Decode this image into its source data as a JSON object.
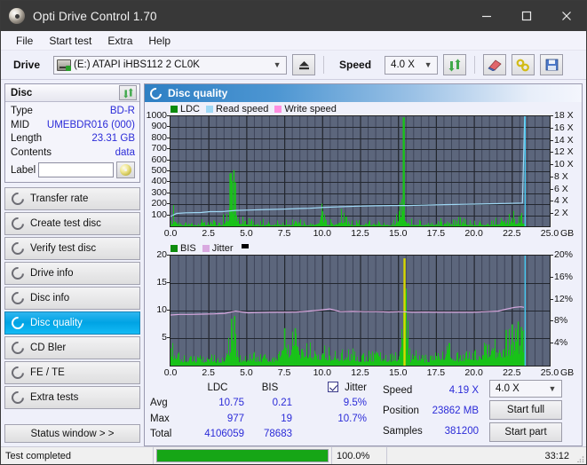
{
  "window": {
    "title": "Opti Drive Control 1.70",
    "app_icon": "disc-icon",
    "minimize": "–",
    "maximize": "□",
    "close": "✕"
  },
  "menu": {
    "items": [
      "File",
      "Start test",
      "Extra",
      "Help"
    ]
  },
  "toolbar": {
    "drive_label": "Drive",
    "drive_value": "(E:)  ATAPI iHBS112  2 CL0K",
    "eject_icon": "eject-icon",
    "speed_label": "Speed",
    "speed_value": "4.0 X",
    "refresh_icon": "refresh-icon",
    "erase_icon": "eraser-icon",
    "tools_icon": "tools-icon",
    "save_icon": "save-icon"
  },
  "disc_panel": {
    "title": "Disc",
    "refresh_icon": "refresh-icon",
    "rows": [
      {
        "key": "Type",
        "value": "BD-R"
      },
      {
        "key": "MID",
        "value": "UMEBDR016 (000)"
      },
      {
        "key": "Length",
        "value": "23.31 GB"
      },
      {
        "key": "Contents",
        "value": "data"
      }
    ],
    "label_key": "Label",
    "label_value": "",
    "label_icon": "cd-icon"
  },
  "sidebar": {
    "items": [
      {
        "label": "Transfer rate",
        "icon": "disc-icon",
        "selected": false
      },
      {
        "label": "Create test disc",
        "icon": "disc-icon",
        "selected": false
      },
      {
        "label": "Verify test disc",
        "icon": "disc-icon",
        "selected": false
      },
      {
        "label": "Drive info",
        "icon": "disc-icon",
        "selected": false
      },
      {
        "label": "Disc info",
        "icon": "disc-icon",
        "selected": false
      },
      {
        "label": "Disc quality",
        "icon": "disc-icon",
        "selected": true
      },
      {
        "label": "CD Bler",
        "icon": "disc-icon",
        "selected": false
      },
      {
        "label": "FE / TE",
        "icon": "disc-icon",
        "selected": false
      },
      {
        "label": "Extra tests",
        "icon": "disc-icon",
        "selected": false
      }
    ],
    "status_window": "Status window > >"
  },
  "content": {
    "header_title": "Disc quality",
    "header_icon": "disc-icon"
  },
  "chart_data": [
    {
      "type": "line",
      "name": "ldc-chart",
      "title": "",
      "xlabel": "GB",
      "ylabel": "",
      "x_unit_label": "GB",
      "xlim": [
        0,
        25
      ],
      "xticks": [
        0.0,
        2.5,
        5.0,
        7.5,
        10.0,
        12.5,
        15.0,
        17.5,
        20.0,
        22.5,
        25.0
      ],
      "xticklabels": [
        "0.0",
        "2.5",
        "5.0",
        "7.5",
        "10.0",
        "12.5",
        "15.0",
        "17.5",
        "20.0",
        "22.5",
        "25.0"
      ],
      "ylim": [
        0,
        1000
      ],
      "yticks": [
        100,
        200,
        300,
        400,
        500,
        600,
        700,
        800,
        900,
        1000
      ],
      "yticklabels": [
        "100",
        "200",
        "300",
        "400",
        "500",
        "600",
        "700",
        "800",
        "900",
        "1000"
      ],
      "y2lim": [
        0,
        18
      ],
      "y2ticks": [
        2,
        4,
        6,
        8,
        10,
        12,
        14,
        16,
        18
      ],
      "y2ticklabels": [
        "2 X",
        "4 X",
        "6 X",
        "8 X",
        "10 X",
        "12 X",
        "14 X",
        "16 X",
        "18 X"
      ],
      "grid": true,
      "legend_position": "top-left",
      "legend": [
        {
          "label": "LDC",
          "color": "#0d8b0d"
        },
        {
          "label": "Read speed",
          "color": "#9fd8f5"
        },
        {
          "label": "Write speed",
          "color": "#ff8fe0"
        }
      ],
      "series": [
        {
          "name": "LDC",
          "type": "bar",
          "color": "#19c219",
          "axis": "left",
          "note": "dense green error bars, baseline ~40-90, spikes at 0.4 (300), 4.2 (510), 9.9 (240), 11.3 (260), 15.4 (990)",
          "x": [
            0.0,
            0.3,
            0.45,
            0.8,
            1.3,
            1.8,
            2.3,
            2.7,
            2.9,
            3.4,
            3.9,
            4.15,
            4.25,
            4.45,
            5.0,
            5.4,
            5.9,
            6.4,
            6.9,
            7.4,
            7.9,
            8.4,
            8.9,
            9.4,
            9.9,
            10.4,
            10.9,
            11.3,
            11.8,
            12.3,
            12.8,
            13.3,
            13.8,
            14.3,
            14.8,
            15.35,
            15.5,
            16.0,
            16.5,
            17.0,
            17.5,
            18.0,
            18.5,
            19.0,
            19.5,
            20.0,
            20.5,
            21.0,
            21.5,
            22.0,
            22.4,
            22.8,
            23.1,
            23.4
          ],
          "y": [
            70,
            300,
            120,
            60,
            55,
            60,
            70,
            140,
            60,
            70,
            480,
            510,
            400,
            110,
            130,
            60,
            70,
            65,
            70,
            60,
            65,
            70,
            60,
            70,
            240,
            60,
            80,
            260,
            70,
            60,
            65,
            60,
            70,
            60,
            65,
            990,
            80,
            70,
            65,
            70,
            80,
            70,
            65,
            100,
            70,
            65,
            60,
            70,
            120,
            150,
            130,
            170,
            200,
            185
          ]
        },
        {
          "name": "Read speed",
          "type": "line",
          "color": "#9fd8f5",
          "axis": "right",
          "x": [
            0.0,
            0.4,
            1.0,
            2.0,
            2.6,
            3.4,
            4.3,
            5.2,
            6.3,
            7.4,
            8.5,
            9.2,
            10.2,
            11.2,
            12.4,
            13.5,
            14.6,
            15.6,
            16.6,
            17.4,
            18.4,
            19.4,
            20.4,
            21.4,
            22.3,
            23.2,
            23.35
          ],
          "y": [
            1.6,
            2.1,
            2.2,
            2.25,
            2.4,
            2.4,
            2.6,
            2.65,
            2.75,
            2.8,
            2.9,
            2.95,
            3.1,
            3.2,
            3.3,
            3.35,
            3.4,
            3.4,
            3.45,
            3.5,
            3.55,
            3.6,
            3.65,
            3.7,
            3.75,
            3.8,
            18.0
          ]
        }
      ],
      "cursor_line": {
        "x": 23.35,
        "color": "#45c8f0"
      }
    },
    {
      "type": "line",
      "name": "bis-jitter-chart",
      "title": "",
      "xlabel": "GB",
      "x_unit_label": "GB",
      "xlim": [
        0,
        25
      ],
      "xticks": [
        0.0,
        2.5,
        5.0,
        7.5,
        10.0,
        12.5,
        15.0,
        17.5,
        20.0,
        22.5,
        25.0
      ],
      "xticklabels": [
        "0.0",
        "2.5",
        "5.0",
        "7.5",
        "10.0",
        "12.5",
        "15.0",
        "17.5",
        "20.0",
        "22.5",
        "25.0"
      ],
      "ylim": [
        0,
        20
      ],
      "yticks": [
        5,
        10,
        15,
        20
      ],
      "yticklabels": [
        "5",
        "10",
        "15",
        "20"
      ],
      "y2lim": [
        0,
        20
      ],
      "y2ticks": [
        4,
        8,
        12,
        16,
        20
      ],
      "y2ticklabels": [
        "4%",
        "8%",
        "12%",
        "16%",
        "20%"
      ],
      "grid": true,
      "legend_position": "top-left",
      "legend": [
        {
          "label": "BIS",
          "color": "#0d8b0d"
        },
        {
          "label": "Jitter",
          "color": "#d9a9e0"
        },
        {
          "label": "",
          "color": "#000000"
        }
      ],
      "series": [
        {
          "name": "BIS",
          "type": "bar",
          "color": "#19c219",
          "axis": "left",
          "note": "dense green bars, typical 1-4, rising to ~8 near 23 GB, yellow spike at 15.4",
          "x": [
            0.1,
            0.5,
            1.0,
            1.5,
            2.0,
            2.5,
            3.0,
            3.5,
            4.0,
            4.2,
            4.5,
            5.0,
            5.5,
            6.0,
            6.5,
            7.0,
            7.5,
            7.8,
            8.2,
            8.6,
            9.0,
            9.5,
            10.0,
            10.5,
            11.0,
            11.5,
            12.0,
            12.5,
            13.0,
            13.5,
            14.0,
            14.5,
            15.0,
            15.4,
            15.8,
            16.3,
            16.8,
            17.3,
            17.8,
            18.3,
            18.8,
            19.3,
            19.8,
            20.2,
            20.7,
            21.2,
            21.7,
            22.1,
            22.5,
            22.9,
            23.1,
            23.3
          ],
          "y": [
            5,
            3,
            2.2,
            1.8,
            2.0,
            2.5,
            1.8,
            2.2,
            8.5,
            9.0,
            2.5,
            2.0,
            3.0,
            2.2,
            2.5,
            2.0,
            6.8,
            5.5,
            6.8,
            4.5,
            5.5,
            3.5,
            4.5,
            3.2,
            3.5,
            3.0,
            3.2,
            2.5,
            3.0,
            2.8,
            3.0,
            2.5,
            3.0,
            19.5,
            2.5,
            3.0,
            2.2,
            2.5,
            3.0,
            4.5,
            2.8,
            3.0,
            4.0,
            3.5,
            5.0,
            5.5,
            4.8,
            6.5,
            7.5,
            8.0,
            7.0,
            6.5
          ]
        },
        {
          "name": "Jitter",
          "type": "line",
          "color": "#d9a9e0",
          "axis": "right",
          "x": [
            0.0,
            0.6,
            1.3,
            2.1,
            2.9,
            3.6,
            4.3,
            5.1,
            5.9,
            6.7,
            7.5,
            8.3,
            9.1,
            9.9,
            10.5,
            11.2,
            12.0,
            12.8,
            13.6,
            14.4,
            15.2,
            16.0,
            16.8,
            17.6,
            18.4,
            19.2,
            20.0,
            20.8,
            21.6,
            22.2,
            22.7,
            23.1,
            23.3
          ],
          "y": [
            9.2,
            9.3,
            9.3,
            9.35,
            9.4,
            9.5,
            9.9,
            9.6,
            9.65,
            9.7,
            9.7,
            9.75,
            9.9,
            10.1,
            10.3,
            9.8,
            9.85,
            9.8,
            9.8,
            9.75,
            9.8,
            9.7,
            9.75,
            9.7,
            9.7,
            9.7,
            9.7,
            9.8,
            9.9,
            10.3,
            10.6,
            10.7,
            10.6
          ]
        }
      ],
      "cursor_line": {
        "x": 23.35,
        "color": "#45c8f0"
      }
    }
  ],
  "stats": {
    "col_headers": [
      "LDC",
      "BIS"
    ],
    "rows": [
      {
        "label": "Avg",
        "ldc": "10.75",
        "bis": "0.21",
        "jitter": "9.5%"
      },
      {
        "label": "Max",
        "ldc": "977",
        "bis": "19",
        "jitter": "10.7%"
      },
      {
        "label": "Total",
        "ldc": "4106059",
        "bis": "78683",
        "jitter": ""
      }
    ],
    "jitter_label": "Jitter",
    "jitter_checked": true,
    "speed_label": "Speed",
    "speed_value": "4.19 X",
    "position_label": "Position",
    "position_value": "23862 MB",
    "samples_label": "Samples",
    "samples_value": "381200",
    "speed_select": "4.0 X",
    "start_full": "Start full",
    "start_part": "Start part"
  },
  "statusbar": {
    "message": "Test completed",
    "progress_percent": 100.0,
    "progress_text": "100.0%",
    "elapsed": "33:12"
  },
  "colors": {
    "plot_background": "#5c667c",
    "grid": "#2b2f3a",
    "green": "#19c219",
    "read_speed": "#9fd8f5",
    "write_speed": "#ff8fe0",
    "jitter": "#d9a9e0",
    "cursor": "#45c8f0",
    "value_text": "#2b2bd8",
    "selection": "#00a3e4"
  }
}
